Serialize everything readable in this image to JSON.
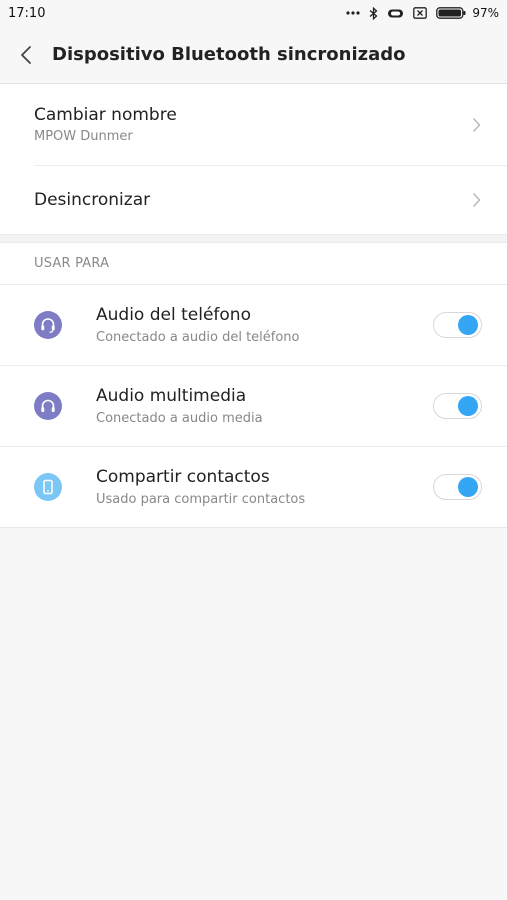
{
  "status_bar": {
    "time": "17:10",
    "battery_percent": "97%"
  },
  "header": {
    "title": "Dispositivo Bluetooth sincronizado"
  },
  "device_options": [
    {
      "title": "Cambiar nombre",
      "subtitle": "MPOW Dunmer"
    },
    {
      "title": "Desincronizar"
    }
  ],
  "use_for": {
    "section_label": "USAR PARA",
    "items": [
      {
        "title": "Audio del teléfono",
        "subtitle": "Conectado a audio del teléfono",
        "icon": "headset-icon",
        "icon_color": "#7e7cc4",
        "enabled": true
      },
      {
        "title": "Audio multimedia",
        "subtitle": "Conectado a audio media",
        "icon": "headphones-icon",
        "icon_color": "#7e7cc4",
        "enabled": true
      },
      {
        "title": "Compartir contactos",
        "subtitle": "Usado para compartir contactos",
        "icon": "phone-icon",
        "icon_color": "#7cc6f5",
        "enabled": true
      }
    ]
  },
  "colors": {
    "toggle_on": "#35a6f3",
    "background": "#f7f7f7"
  }
}
